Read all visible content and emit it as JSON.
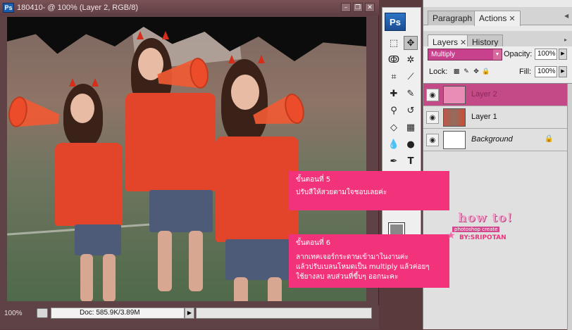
{
  "document": {
    "title": "180410- @ 100% (Layer 2, RGB/8)",
    "zoom_status": "100%",
    "doc_info": "Doc: 585.9K/3.89M"
  },
  "tools": {
    "logo": "Ps"
  },
  "panel_top": {
    "tabs": [
      {
        "label": "Paragraph"
      },
      {
        "label": "Actions"
      }
    ]
  },
  "layers_panel": {
    "tabs": [
      {
        "label": "Layers"
      },
      {
        "label": "History"
      }
    ],
    "blend_mode": "Multiply",
    "opacity_label": "Opacity:",
    "opacity_value": "100%",
    "lock_label": "Lock:",
    "fill_label": "Fill:",
    "fill_value": "100%",
    "layers": [
      {
        "name": "Layer 2",
        "selected": true
      },
      {
        "name": "Layer 1",
        "selected": false
      },
      {
        "name": "Background",
        "selected": false
      }
    ]
  },
  "notes": {
    "step5_title": "ขั้นตอนที่ 5",
    "step5_text": "ปรับสีให้สวยตามใจชอบเลยค่ะ",
    "step6_title": "ขั้นตอนที่ 6",
    "step6_line1": "ลากเทคเจอร์กระดาษเข้ามาในงานค่ะ",
    "step6_line2": "แล้วปรับเบลนโหมดเป็น multiply แล้วค่อยๆ",
    "step6_line3": "ใช้ยางลบ ลบส่วนที่ขี้บๆ ออกนะคะ"
  },
  "watermark": {
    "line1": "how to!",
    "line2": "photoshop create",
    "line3": "BY:SRIPOTAN"
  },
  "colors": {
    "accent_pink": "#f2327a",
    "selected_layer": "#c34a86",
    "chrome": "#5e4245"
  }
}
